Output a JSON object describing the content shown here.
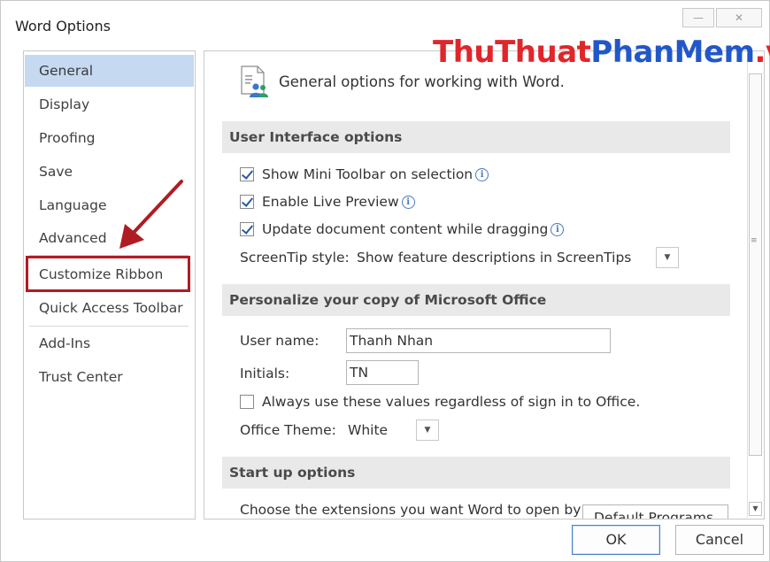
{
  "window": {
    "title": "Word Options",
    "minimize_glyph": "—",
    "close_glyph": "✕"
  },
  "watermark": {
    "part1": "ThuThuat",
    "part2": "PhanMem",
    "part3": ".vn"
  },
  "sidebar": {
    "items": [
      {
        "label": "General",
        "selected": true
      },
      {
        "label": "Display"
      },
      {
        "label": "Proofing"
      },
      {
        "label": "Save"
      },
      {
        "label": "Language"
      },
      {
        "label": "Advanced"
      },
      {
        "label": "Customize Ribbon",
        "highlighted": true
      },
      {
        "label": "Quick Access Toolbar"
      },
      {
        "label": "Add-Ins"
      },
      {
        "label": "Trust Center"
      }
    ]
  },
  "main": {
    "header_text": "General options for working with Word.",
    "header_icon": "general-options-icon",
    "sections": {
      "ui": {
        "title": "User Interface options",
        "options": [
          {
            "label": "Show Mini Toolbar on selection",
            "checked": true
          },
          {
            "label": "Enable Live Preview",
            "checked": true
          },
          {
            "label": "Update document content while dragging",
            "checked": true
          }
        ],
        "screentip_label": "ScreenTip style:",
        "screentip_value": "Show feature descriptions in ScreenTips"
      },
      "personalize": {
        "title": "Personalize your copy of Microsoft Office",
        "username_label": "User name:",
        "username_value": "Thanh Nhan",
        "initials_label": "Initials:",
        "initials_value": "TN",
        "always_use_label": "Always use these values regardless of sign in to Office.",
        "always_use_checked": false,
        "theme_label": "Office Theme:",
        "theme_value": "White"
      },
      "startup": {
        "title": "Start up options",
        "extensions_text": "Choose the extensions you want Word to open by",
        "default_programs_label": "Default Programs..."
      }
    }
  },
  "buttons": {
    "ok": "OK",
    "cancel": "Cancel"
  },
  "colors": {
    "selected_nav": "#c5d9f1",
    "annotation_red": "#b01c24",
    "section_bg": "#e9e9e9"
  }
}
